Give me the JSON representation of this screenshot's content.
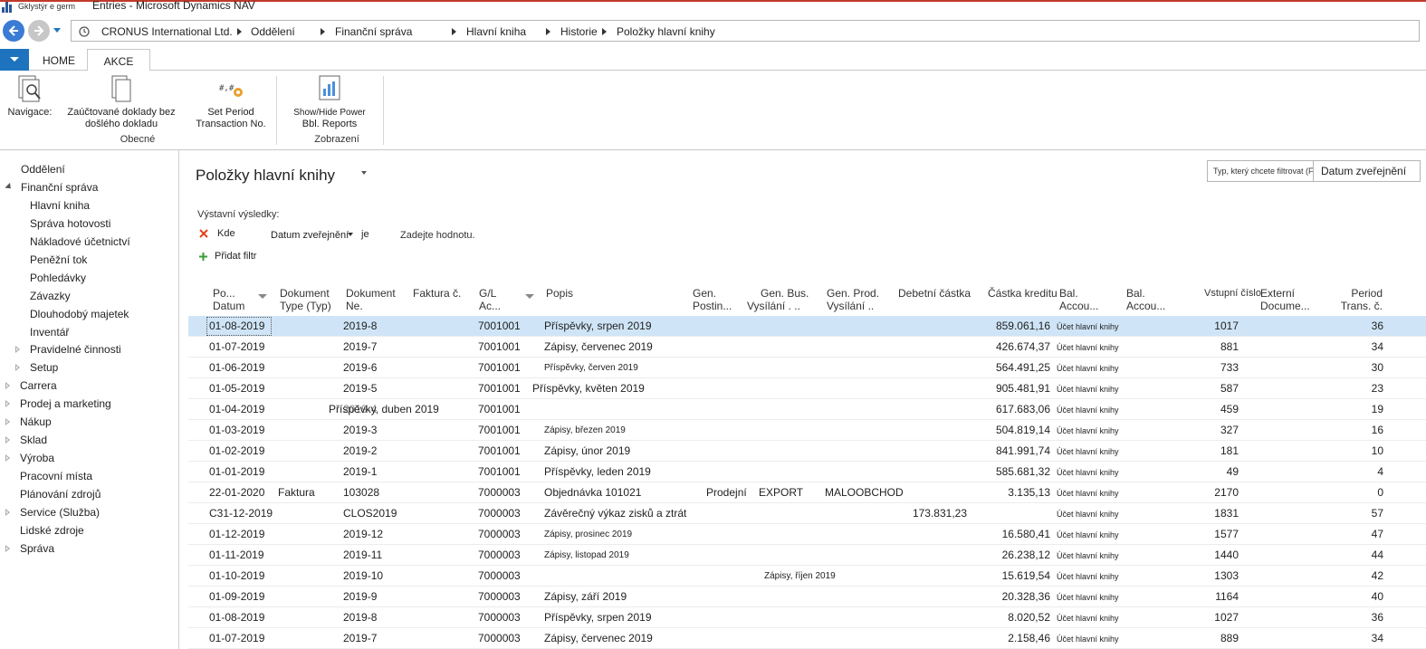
{
  "window": {
    "small_label": "Gklystýr e germ",
    "title": "Entries - Microsoft Dynamics NAV"
  },
  "breadcrumb": [
    "CRONUS International Ltd.",
    "Oddělení",
    "Finanční správa",
    "Hlavní kniha",
    "Historie",
    "Položky hlavní knihy"
  ],
  "ribbon": {
    "tabs": [
      "HOME",
      "AKCE"
    ],
    "active_tab": "AKCE",
    "buttons": {
      "navigace": "Navigace:",
      "zauctovane_1": "Zaúčtované doklady bez",
      "zauctovane_2": "došlého dokladu",
      "set_period_1": "Set Period",
      "set_period_2": "Transaction No.",
      "power_1": "Show/Hide Power",
      "power_2": "Bbl. Reports"
    },
    "groups": {
      "obecne": "Obecné",
      "zobrazeni": "Zobrazení"
    }
  },
  "sidebar": {
    "items": [
      "Oddělení",
      "Finanční správa",
      "Hlavní kniha",
      "Správa hotovosti",
      "Nákladové účetnictví",
      "Peněžní tok",
      "Pohledávky",
      "Závazky",
      "Dlouhodobý majetek",
      "Inventář",
      "Pravidelné činnosti",
      "Setup",
      "Carrera",
      "Prodej a marketing",
      "Nákup",
      "Sklad",
      "Výroba",
      "Pracovní místa",
      "Plánování zdrojů",
      "Service (Služba)",
      "Lidské zdroje",
      "Správa"
    ]
  },
  "page": {
    "title": "Položky hlavní knihy",
    "search_placeholder": "Typ, který chcete filtrovat (F3)",
    "search_field": "Datum zveřejnění"
  },
  "filter": {
    "heading": "Výstavní výsledky:",
    "where": "Kde",
    "field": "Datum zveřejnění",
    "operator": "je",
    "value": "Zadejte hodnotu.",
    "add": "Přidat filtr"
  },
  "grid": {
    "headers": {
      "date_1": "Po...",
      "date_2": "Datum",
      "doctype_1": "Dokument",
      "doctype_2": "Type (Typ)",
      "docno_1": "Dokument",
      "docno_2": "Ne.",
      "invoice": "Faktura č.",
      "gl_1": "G/L",
      "gl_2": "Ac...",
      "desc": "Popis",
      "genpost_1": "Gen.",
      "genpost_2": "Postin...",
      "genbus_1": "Gen. Bus.",
      "genbus_2": "Vysílání .",
      "genbus_3": "..",
      "genprod_1": "Gen. Prod.",
      "genprod_2": "Vysílání ..",
      "debit": "Debetní částka",
      "credit": "Částka kreditu",
      "balacc_1": "Bal.",
      "balacc_2": "Accou...",
      "balacc2_1": "Bal.",
      "balacc2_2": "Accou...",
      "entry_no": "Vstupní číslo",
      "extdoc_1": "Externí",
      "extdoc_2": "Docume...",
      "period_1": "Period",
      "period_2": "Trans. č."
    },
    "rows": [
      {
        "date": "01-08-2019",
        "doctype": "",
        "docno": "2019-8",
        "gl": "7001001",
        "desc": "Příspěvky, srpen 2019",
        "genpost": "",
        "genbus": "",
        "genprod": "",
        "debit": "",
        "credit": "859.061,16",
        "balacc": "Účet hlavní knihy",
        "entry": "1017",
        "period": "36"
      },
      {
        "date": "01-07-2019",
        "doctype": "",
        "docno": "2019-7",
        "gl": "7001001",
        "desc": "Zápisy, červenec 2019",
        "genpost": "",
        "genbus": "",
        "genprod": "",
        "debit": "",
        "credit": "426.674,37",
        "balacc": "Účet hlavní knihy",
        "entry": "881",
        "period": "34"
      },
      {
        "date": "01-06-2019",
        "doctype": "",
        "docno": "2019-6",
        "gl": "7001001",
        "desc": "Příspěvky, červen 2019",
        "genpost": "",
        "genbus": "",
        "genprod": "",
        "debit": "",
        "credit": "564.491,25",
        "balacc": "Účet hlavní knihy",
        "entry": "733",
        "period": "30"
      },
      {
        "date": "01-05-2019",
        "doctype": "",
        "docno": "2019-5",
        "gl": "7001001",
        "desc": "Příspěvky, květen 2019",
        "genpost": "",
        "genbus": "",
        "genprod": "",
        "debit": "",
        "credit": "905.481,91",
        "balacc": "Účet hlavní knihy",
        "entry": "587",
        "period": "23"
      },
      {
        "date": "01-04-2019",
        "doctype": "",
        "docno": "2019-4",
        "gl": "7001001",
        "desc": "Příspěvky, duben 2019",
        "genpost": "",
        "genbus": "",
        "genprod": "",
        "debit": "",
        "credit": "617.683,06",
        "balacc": "Účet hlavní knihy",
        "entry": "459",
        "period": "19"
      },
      {
        "date": "01-03-2019",
        "doctype": "",
        "docno": "2019-3",
        "gl": "7001001",
        "desc": "Zápisy, březen 2019",
        "genpost": "",
        "genbus": "",
        "genprod": "",
        "debit": "",
        "credit": "504.819,14",
        "balacc": "Účet hlavní knihy",
        "entry": "327",
        "period": "16"
      },
      {
        "date": "01-02-2019",
        "doctype": "",
        "docno": "2019-2",
        "gl": "7001001",
        "desc": "Zápisy, únor 2019",
        "genpost": "",
        "genbus": "",
        "genprod": "",
        "debit": "",
        "credit": "841.991,74",
        "balacc": "Účet hlavní knihy",
        "entry": "181",
        "period": "10"
      },
      {
        "date": "01-01-2019",
        "doctype": "",
        "docno": "2019-1",
        "gl": "7001001",
        "desc": "Příspěvky, leden 2019",
        "genpost": "",
        "genbus": "",
        "genprod": "",
        "debit": "",
        "credit": "585.681,32",
        "balacc": "Účet hlavní knihy",
        "entry": "49",
        "period": "4"
      },
      {
        "date": "22-01-2020",
        "doctype": "Faktura",
        "docno": "103028",
        "gl": "7000003",
        "desc": "Objednávka 101021",
        "genpost": "Prodejní",
        "genbus": "EXPORT",
        "genprod": "MALOOBCHOD",
        "debit": "",
        "credit": "3.135,13",
        "balacc": "Účet hlavní knihy",
        "entry": "2170",
        "period": "0"
      },
      {
        "date": "C31-12-2019",
        "doctype": "",
        "docno": "CLOS2019",
        "gl": "7000003",
        "desc": "Závěrečný výkaz zisků a ztrát",
        "genpost": "",
        "genbus": "",
        "genprod": "",
        "debit": "173.831,23",
        "credit": "",
        "balacc": "Účet hlavní knihy",
        "entry": "1831",
        "period": "57"
      },
      {
        "date": "01-12-2019",
        "doctype": "",
        "docno": "2019-12",
        "gl": "7000003",
        "desc": "Zápisy, prosinec 2019",
        "genpost": "",
        "genbus": "",
        "genprod": "",
        "debit": "",
        "credit": "16.580,41",
        "balacc": "Účet hlavní knihy",
        "entry": "1577",
        "period": "47"
      },
      {
        "date": "01-11-2019",
        "doctype": "",
        "docno": "2019-11",
        "gl": "7000003",
        "desc": "Zápisy, listopad 2019",
        "genpost": "",
        "genbus": "",
        "genprod": "",
        "debit": "",
        "credit": "26.238,12",
        "balacc": "Účet hlavní knihy",
        "entry": "1440",
        "period": "44"
      },
      {
        "date": "01-10-2019",
        "doctype": "",
        "docno": "2019-10",
        "gl": "7000003",
        "desc": "Zápisy, říjen 2019",
        "genpost": "",
        "genbus": "",
        "genprod": "",
        "debit": "",
        "credit": "15.619,54",
        "balacc": "Účet hlavní knihy",
        "entry": "1303",
        "period": "42"
      },
      {
        "date": "01-09-2019",
        "doctype": "",
        "docno": "2019-9",
        "gl": "7000003",
        "desc": "Zápisy, září 2019",
        "genpost": "",
        "genbus": "",
        "genprod": "",
        "debit": "",
        "credit": "20.328,36",
        "balacc": "Účet hlavní knihy",
        "entry": "1164",
        "period": "40"
      },
      {
        "date": "01-08-2019",
        "doctype": "",
        "docno": "2019-8",
        "gl": "7000003",
        "desc": "Příspěvky, srpen 2019",
        "genpost": "",
        "genbus": "",
        "genprod": "",
        "debit": "",
        "credit": "8.020,52",
        "balacc": "Účet hlavní knihy",
        "entry": "1027",
        "period": "36"
      },
      {
        "date": "01-07-2019",
        "doctype": "",
        "docno": "2019-7",
        "gl": "7000003",
        "desc": "Zápisy, červenec 2019",
        "genpost": "",
        "genbus": "",
        "genprod": "",
        "debit": "",
        "credit": "2.158,46",
        "balacc": "Účet hlavní knihy",
        "entry": "889",
        "period": "34"
      }
    ]
  },
  "colors": {
    "accent": "#1e73be",
    "selected_row": "#cfe5f7",
    "remove_filter": "#e2401c",
    "add_filter": "#3a9b3a"
  }
}
